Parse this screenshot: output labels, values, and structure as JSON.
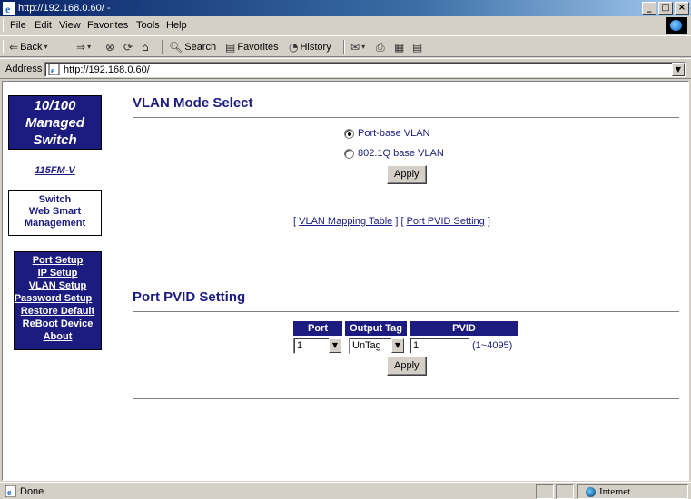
{
  "window": {
    "title": "http://192.168.0.60/ -",
    "controls": [
      "_",
      "□",
      "×"
    ]
  },
  "menubar": {
    "items": [
      "File",
      "Edit",
      "View",
      "Favorites",
      "Tools",
      "Help"
    ]
  },
  "toolbar": {
    "back": "Back",
    "search": "Search",
    "favorites": "Favorites",
    "history": "History"
  },
  "address": {
    "label": "Address",
    "url": "http://192.168.0.60/"
  },
  "sidebar": {
    "brand_lines": [
      "10/100",
      "Managed",
      "Switch"
    ],
    "model": "115FM-V",
    "management_lines": [
      "Switch",
      "Web Smart",
      "Management"
    ],
    "nav": [
      "Port Setup",
      "IP Setup",
      "VLAN Setup",
      "Password Setup",
      "Restore Default",
      "ReBoot Device",
      "About"
    ]
  },
  "vlan_mode": {
    "heading": "VLAN Mode Select",
    "options": [
      {
        "label": "Port-base VLAN",
        "selected": true
      },
      {
        "label": "802.1Q base VLAN",
        "selected": false
      }
    ],
    "apply": "Apply"
  },
  "links": {
    "open": "[",
    "mapping": "VLAN Mapping Table",
    "middle": "] [",
    "pvid": "Port PVID Setting",
    "close": "]"
  },
  "pvid": {
    "heading": "Port PVID Setting",
    "headers": [
      "Port",
      "Output Tag",
      "PVID"
    ],
    "port_value": "1",
    "tag_value": "UnTag",
    "pvid_value": "1",
    "range": "(1~4095)",
    "apply": "Apply"
  },
  "status": {
    "text": "Done",
    "zone": "Internet"
  },
  "colors": {
    "accent": "#1c1c80",
    "chrome": "#d4d0c8"
  }
}
